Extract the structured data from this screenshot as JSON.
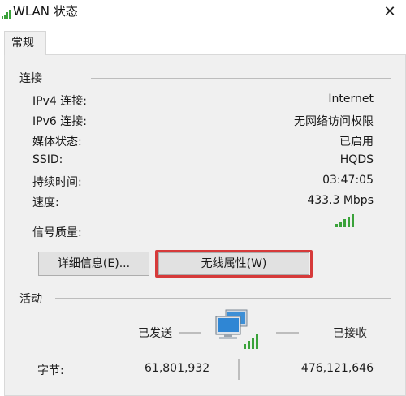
{
  "window": {
    "title": "WLAN 状态",
    "close_glyph": "✕"
  },
  "tabs": [
    {
      "label": "常规",
      "active": true
    }
  ],
  "connection": {
    "section_title": "连接",
    "rows": [
      {
        "label": "IPv4 连接:",
        "value": "Internet"
      },
      {
        "label": "IPv6 连接:",
        "value": "无网络访问权限"
      },
      {
        "label": "媒体状态:",
        "value": "已启用"
      },
      {
        "label": "SSID:",
        "value": "HQDS"
      },
      {
        "label": "持续时间:",
        "value": "03:47:05"
      },
      {
        "label": "速度:",
        "value": "433.3 Mbps"
      }
    ],
    "signal": {
      "label": "信号质量:",
      "bars_filled": 5,
      "bars_total": 5,
      "color": "#3aa23a"
    }
  },
  "buttons": {
    "details": "详细信息(E)...",
    "wireless_properties": "无线属性(W)"
  },
  "activity": {
    "section_title": "活动",
    "sent_label": "已发送",
    "received_label": "已接收",
    "bytes_label": "字节:",
    "bytes_sent": "61,801,932",
    "bytes_received": "476,121,646"
  },
  "colors": {
    "highlight_frame": "#d63a3a",
    "panel_bg": "#f0f0f0"
  }
}
